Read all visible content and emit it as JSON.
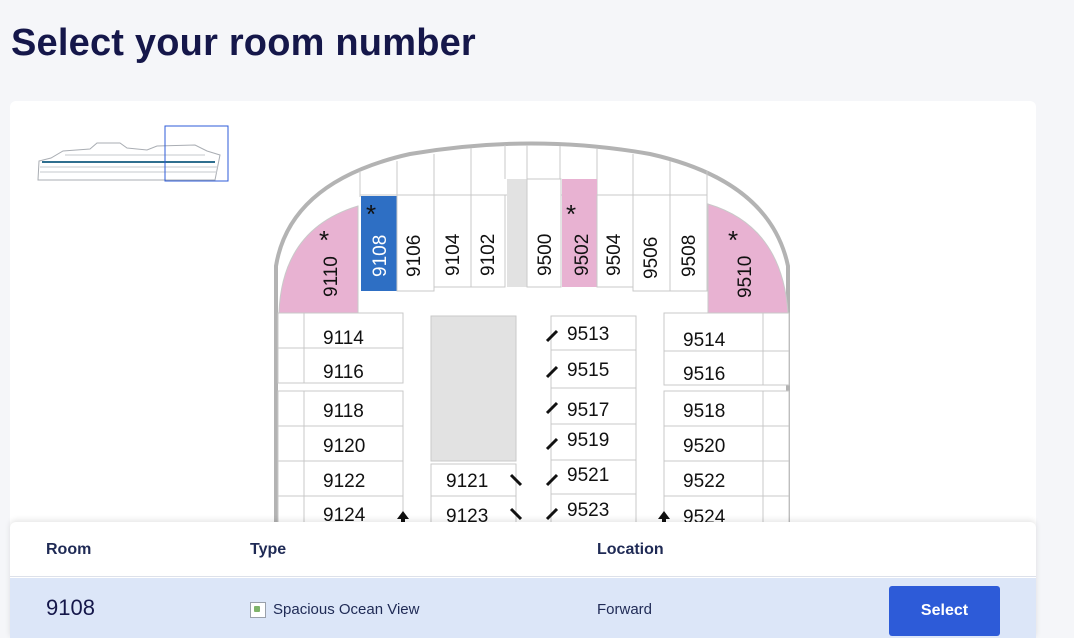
{
  "page": {
    "title": "Select your room number"
  },
  "deck_plan": {
    "forward_row": [
      "9110",
      "9108",
      "9106",
      "9104",
      "9102",
      "9500",
      "9502",
      "9504",
      "9506",
      "9508",
      "9510"
    ],
    "left_column": [
      "9114",
      "9116",
      "9118",
      "9120",
      "9122",
      "9124"
    ],
    "inner_left_column": [
      "9121",
      "9123"
    ],
    "inner_right_column": [
      "9513",
      "9515",
      "9517",
      "9519",
      "9521",
      "9523"
    ],
    "right_column": [
      "9514",
      "9516",
      "9518",
      "9520",
      "9522",
      "9524"
    ],
    "marker": "*",
    "colors": {
      "selected": "#2e6fc4",
      "accessible": "#e8b2d2",
      "unavailable": "#e2e2e2"
    }
  },
  "table": {
    "headers": {
      "room": "Room",
      "type": "Type",
      "location": "Location"
    },
    "row": {
      "room": "9108",
      "type": "Spacious Ocean View",
      "location": "Forward",
      "button": "Select"
    }
  }
}
